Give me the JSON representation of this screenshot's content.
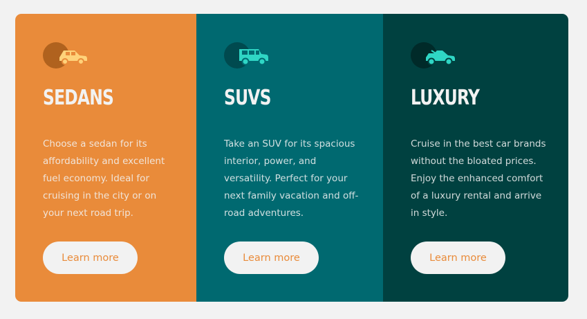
{
  "cards": [
    {
      "icon": "sedan-car-icon",
      "title": "Sedans",
      "description": "Choose a sedan for its affordability and excellent fuel economy. Ideal for cruising in the city or on your next road trip.",
      "button_label": "Learn more",
      "background": "#e98b3a"
    },
    {
      "icon": "suv-car-icon",
      "title": "SUVs",
      "description": "Take an SUV for its spacious interior, power, and versatility. Perfect for your next family vacation and off-road adventures.",
      "button_label": "Learn more",
      "background": "#006970"
    },
    {
      "icon": "luxury-car-icon",
      "title": "Luxury",
      "description": "Cruise in the best car brands without the bloated prices. Enjoy the enhanced comfort of a luxury rental and arrive in style.",
      "button_label": "Learn more",
      "background": "#004140"
    }
  ],
  "colors": {
    "page_background": "#f2f2f2",
    "button_background": "#f2f2f2",
    "heading_text": "#f2f2f2",
    "button_text": "#e98b3a"
  }
}
